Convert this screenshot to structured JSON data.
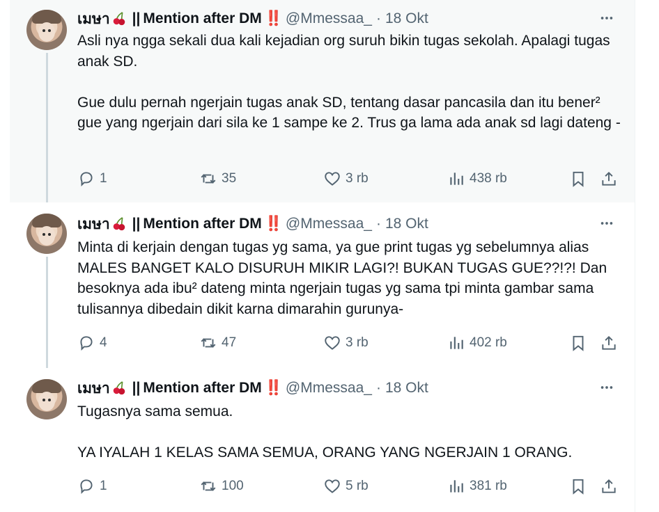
{
  "tweets": [
    {
      "author": {
        "name": "เมษา",
        "separator": "||",
        "suffix": "Mention after DM",
        "marks": "‼️",
        "handle": "@Mmessaa_"
      },
      "dot": "·",
      "time": "18 Okt",
      "paragraphs": [
        "Asli nya ngga sekali dua kali kejadian org suruh bikin tugas sekolah. Apalagi tugas anak SD.",
        "Gue dulu pernah ngerjain tugas anak SD, tentang dasar pancasila dan itu bener² gue yang ngerjain dari sila ke 1 sampe ke 2. Trus ga lama ada anak sd lagi dateng -"
      ],
      "actions": {
        "reply": "1",
        "retweet": "35",
        "like": "3 rb",
        "views": "438 rb"
      }
    },
    {
      "author": {
        "name": "เมษา",
        "separator": "||",
        "suffix": "Mention after DM",
        "marks": "‼️",
        "handle": "@Mmessaa_"
      },
      "dot": "·",
      "time": "18 Okt",
      "paragraphs": [
        "Minta di kerjain dengan tugas yg sama, ya gue print tugas yg sebelumnya alias MALES BANGET KALO DISURUH MIKIR LAGI?! BUKAN TUGAS GUE??!?! Dan besoknya ada ibu² dateng minta ngerjain tugas yg sama tpi minta gambar sama tulisannya dibedain dikit karna dimarahin gurunya-"
      ],
      "actions": {
        "reply": "4",
        "retweet": "47",
        "like": "3 rb",
        "views": "402 rb"
      }
    },
    {
      "author": {
        "name": "เมษา",
        "separator": "||",
        "suffix": "Mention after DM",
        "marks": "‼️",
        "handle": "@Mmessaa_"
      },
      "dot": "·",
      "time": "18 Okt",
      "paragraphs": [
        "Tugasnya sama semua.",
        "YA IYALAH 1 KELAS SAMA SEMUA, ORANG YANG NGERJAIN 1 ORANG."
      ],
      "actions": {
        "reply": "1",
        "retweet": "100",
        "like": "5 rb",
        "views": "381 rb"
      }
    }
  ],
  "icons": {
    "cherry": "cherry-emoji",
    "reply": "reply-icon",
    "retweet": "retweet-icon",
    "like": "heart-icon",
    "views": "views-icon",
    "bookmark": "bookmark-icon",
    "share": "share-icon",
    "more": "more-icon"
  },
  "colors": {
    "name": "#0f1419",
    "secondary": "#536471",
    "accent": "#e0245e",
    "highlight_bg": "#f7f9f9",
    "thread_line": "#cfd9de"
  }
}
